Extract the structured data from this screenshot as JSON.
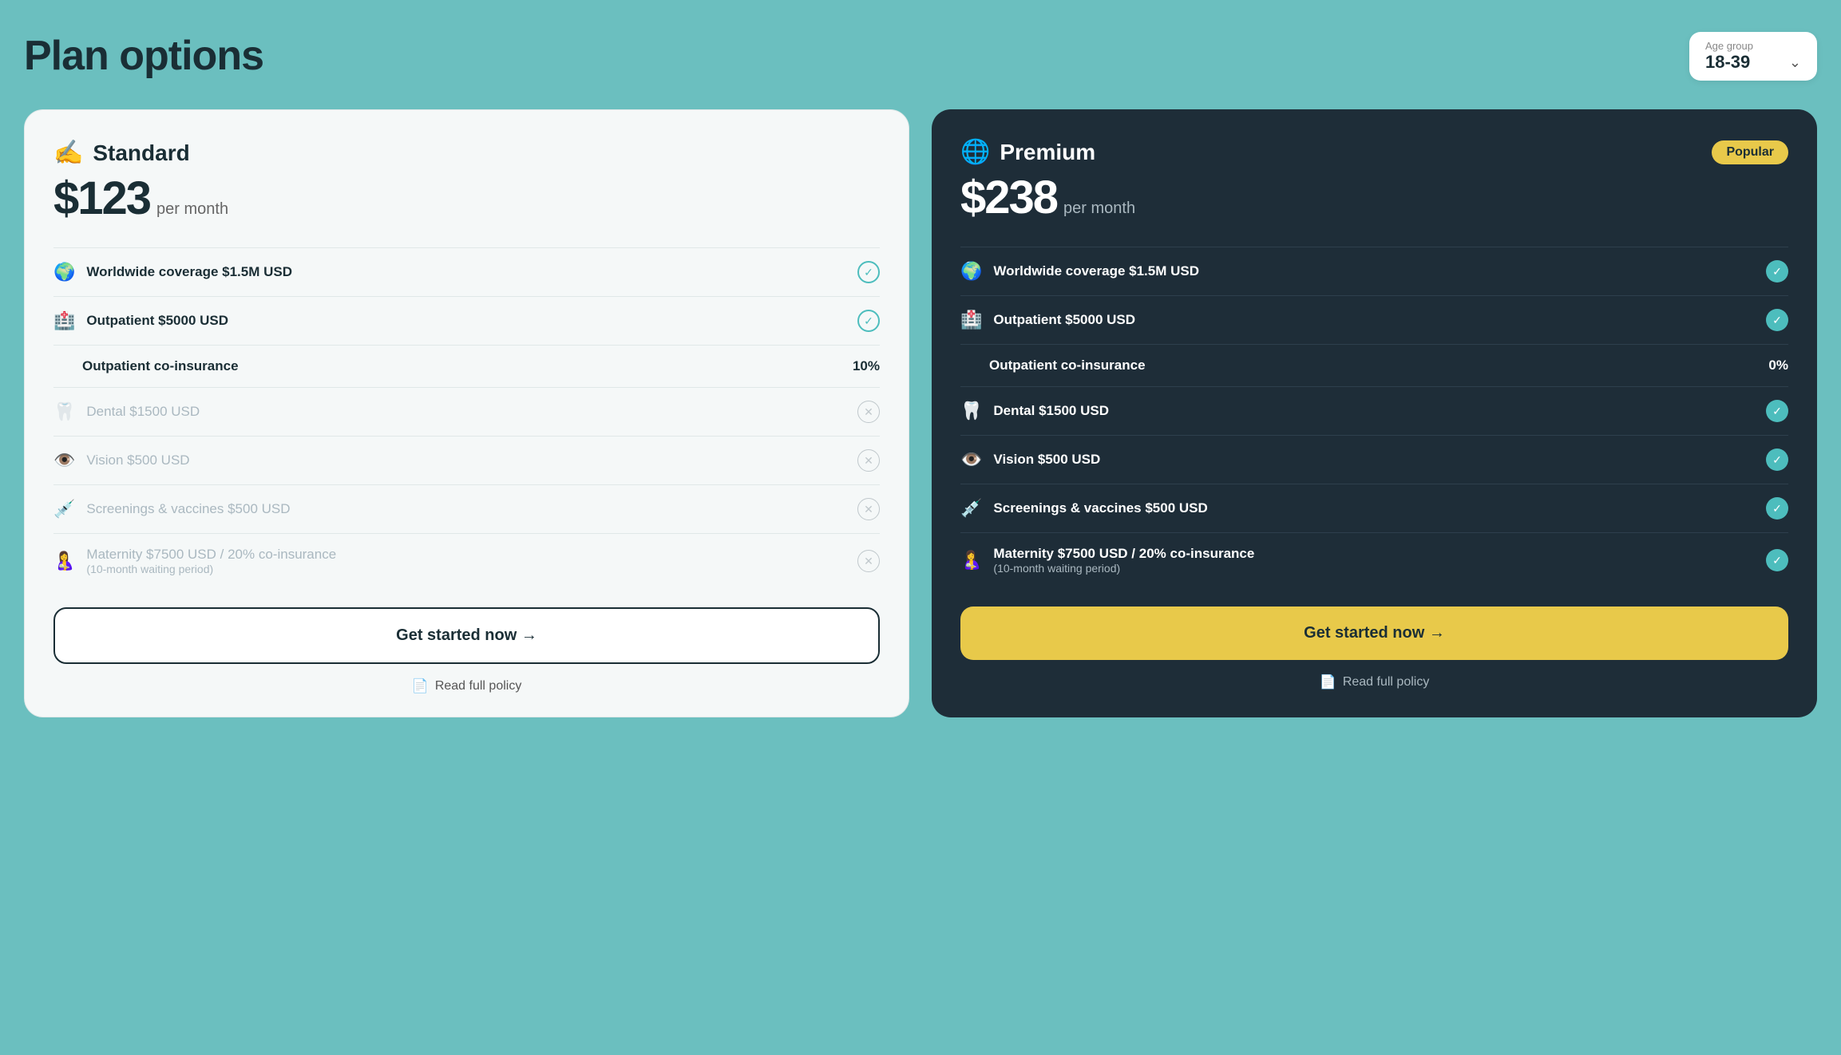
{
  "page": {
    "title": "Plan options",
    "background_color": "#6BBFBF"
  },
  "age_group": {
    "label": "Age group",
    "value": "18-39",
    "chevron": "∨"
  },
  "plans": {
    "standard": {
      "name": "Standard",
      "icon": "✍️",
      "price": "$123",
      "period": "per month",
      "features": [
        {
          "icon": "🌍",
          "text": "Worldwide coverage $1.5M USD",
          "active": true,
          "check": "teal"
        },
        {
          "icon": "🏥",
          "text": "Outpatient $5000 USD",
          "active": true,
          "check": "teal"
        },
        {
          "coinsurance": true,
          "label": "Outpatient co-insurance",
          "value": "10%"
        },
        {
          "icon": "🦷",
          "text": "Dental $1500 USD",
          "active": false,
          "check": "x-gray"
        },
        {
          "icon": "👁️",
          "text": "Vision $500 USD",
          "active": false,
          "check": "x-gray"
        },
        {
          "icon": "💉",
          "text": "Screenings & vaccines $500 USD",
          "active": false,
          "check": "x-gray"
        },
        {
          "icon": "🤱",
          "text": "Maternity $7500 USD / 20% co-insurance",
          "subtext": "(10-month waiting period)",
          "active": false,
          "check": "x-gray"
        }
      ],
      "cta_label": "Get started now →",
      "policy_label": "Read full policy"
    },
    "premium": {
      "name": "Premium",
      "icon": "🌐",
      "price": "$238",
      "period": "per month",
      "badge": "Popular",
      "features": [
        {
          "icon": "🌍",
          "text": "Worldwide coverage $1.5M USD",
          "active": true,
          "check": "filled-teal"
        },
        {
          "icon": "🏥",
          "text": "Outpatient $5000 USD",
          "active": true,
          "check": "filled-teal"
        },
        {
          "coinsurance": true,
          "label": "Outpatient co-insurance",
          "value": "0%"
        },
        {
          "icon": "🦷",
          "text": "Dental $1500 USD",
          "active": true,
          "check": "filled-teal"
        },
        {
          "icon": "👁️",
          "text": "Vision $500 USD",
          "active": true,
          "check": "filled-teal"
        },
        {
          "icon": "💉",
          "text": "Screenings & vaccines $500 USD",
          "active": true,
          "check": "filled-teal"
        },
        {
          "icon": "🤱",
          "text": "Maternity $7500 USD / 20% co-insurance",
          "subtext": "(10-month waiting period)",
          "active": true,
          "check": "filled-teal"
        }
      ],
      "cta_label": "Get started now →",
      "policy_label": "Read full policy"
    }
  }
}
